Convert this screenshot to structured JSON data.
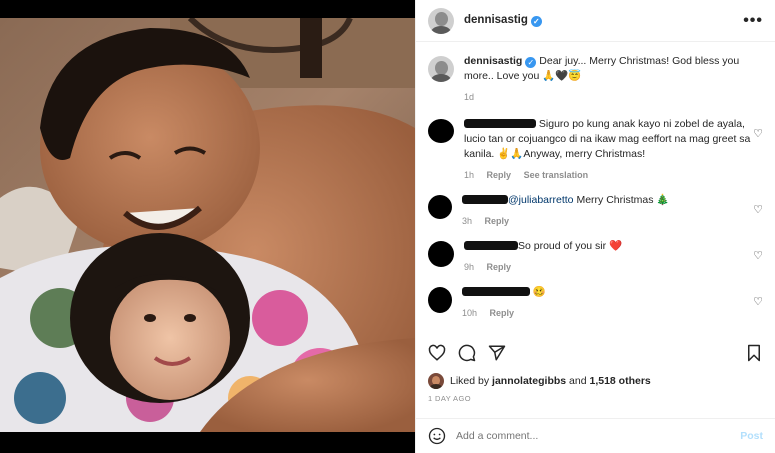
{
  "post": {
    "username": "dennisastig",
    "verified_icon": "✓",
    "more_icon": "•••"
  },
  "caption": {
    "username": "dennisastig",
    "text": " Dear juy... Merry Christmas! God bless you more.. Love you 🙏🖤😇",
    "time": "1d"
  },
  "comments": [
    {
      "text": "Siguro po kung anak kayo ni zobel de ayala, lucio tan or cojuangco di na ikaw mag eeffort na mag greet sa kanila. ✌️🙏Anyway, merry Christmas!",
      "time": "1h",
      "reply": "Reply",
      "translate": "See translation"
    },
    {
      "mention": "@juliabarretto",
      "text": " Merry Christmas 🎄",
      "time": "3h",
      "reply": "Reply"
    },
    {
      "text": "So proud of you sir ",
      "heart": "❤️",
      "time": "9h",
      "reply": "Reply"
    },
    {
      "text": " 🥴",
      "time": "10h",
      "reply": "Reply"
    }
  ],
  "likes": {
    "prefix": "Liked by ",
    "user": "jannolategibbs",
    "middle": " and ",
    "count": "1,518 others"
  },
  "date": "1 DAY AGO",
  "add_comment": {
    "placeholder": "Add a comment...",
    "post_label": "Post"
  },
  "colors": {
    "link": "#00376b",
    "verified": "#3897f0",
    "post_button_disabled": "#b2dffc",
    "heart": "#ed4956"
  }
}
